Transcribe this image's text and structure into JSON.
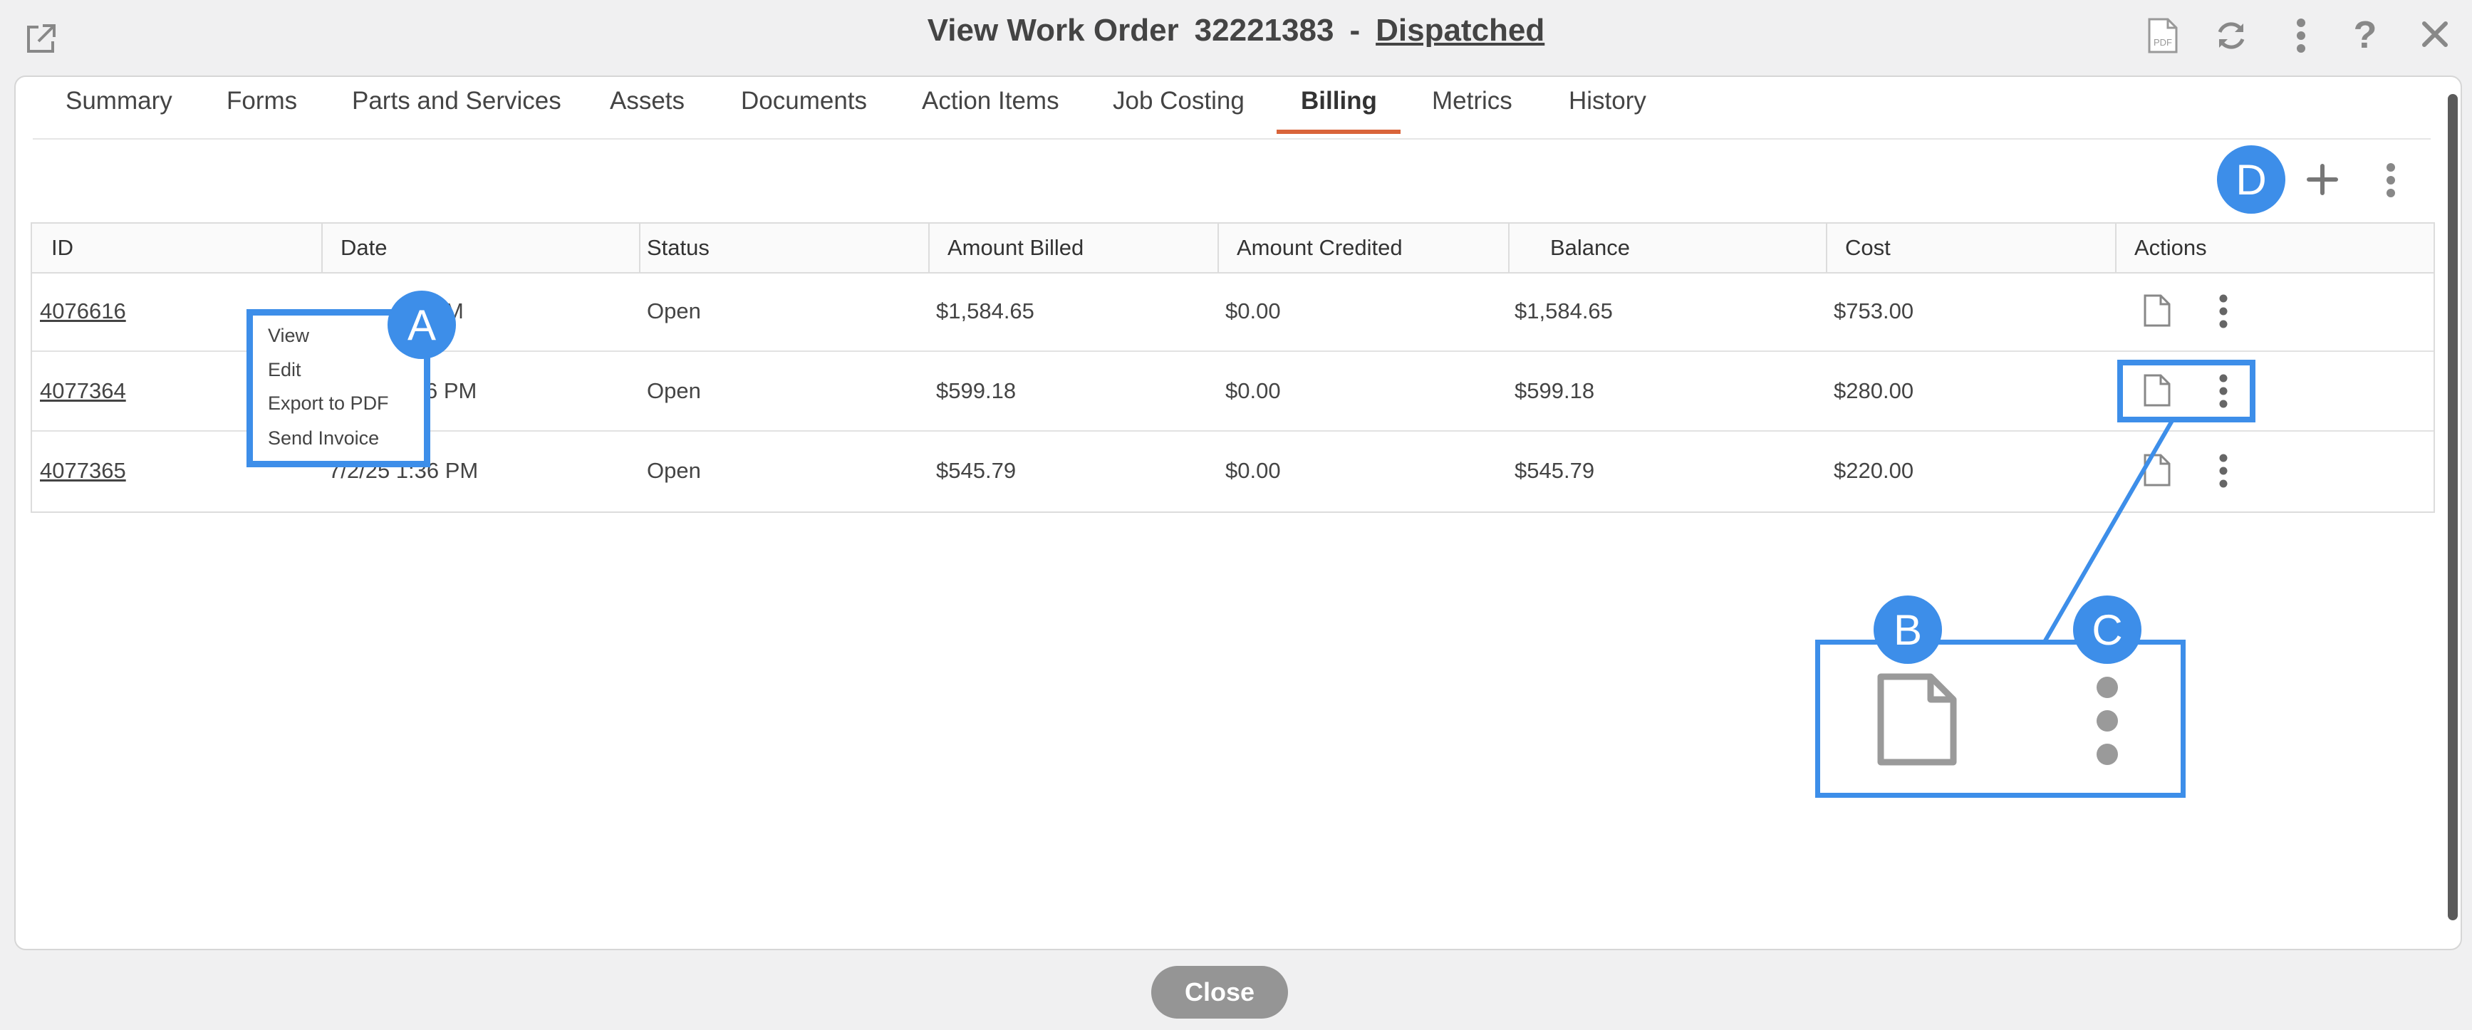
{
  "header": {
    "title_prefix": "View Work Order",
    "work_order_number": "32221383",
    "separator": "-",
    "status": "Dispatched",
    "icons": [
      "external-link-icon",
      "pdf-icon",
      "refresh-icon",
      "more-vert-icon",
      "help-icon",
      "close-icon"
    ],
    "pdf_icon_text": "PDF"
  },
  "tabs": [
    "Summary",
    "Forms",
    "Parts and Services",
    "Assets",
    "Documents",
    "Action Items",
    "Job Costing",
    "Billing",
    "Metrics",
    "History"
  ],
  "active_tab": "Billing",
  "toolbar": {
    "callout_d": "D",
    "icons": [
      "add-icon",
      "more-vert-icon"
    ]
  },
  "table": {
    "columns": [
      "ID",
      "Date",
      "Status",
      "Amount Billed",
      "Amount Credited",
      "Balance",
      "Cost",
      "Actions"
    ],
    "rows": [
      {
        "id": "4076616",
        "date_fragment": "M",
        "status": "Open",
        "billed": "$1,584.65",
        "credited": "$0.00",
        "balance": "$1,584.65",
        "cost": "$753.00"
      },
      {
        "id": "4077364",
        "date_fragment": "6 PM",
        "status": "Open",
        "billed": "$599.18",
        "credited": "$0.00",
        "balance": "$599.18",
        "cost": "$280.00"
      },
      {
        "id": "4077365",
        "date": "7/2/25 1:36 PM",
        "status": "Open",
        "billed": "$545.79",
        "credited": "$0.00",
        "balance": "$545.79",
        "cost": "$220.00"
      }
    ]
  },
  "context_menu": {
    "callout": "A",
    "items": [
      "View",
      "Edit",
      "Export to PDF",
      "Send Invoice"
    ]
  },
  "zoom_callouts": {
    "b": "B",
    "c": "C"
  },
  "footer": {
    "close_label": "Close"
  },
  "colors": {
    "accent": "#3d8ee9",
    "tab_underline": "#d9643a",
    "close_button": "#959595"
  }
}
